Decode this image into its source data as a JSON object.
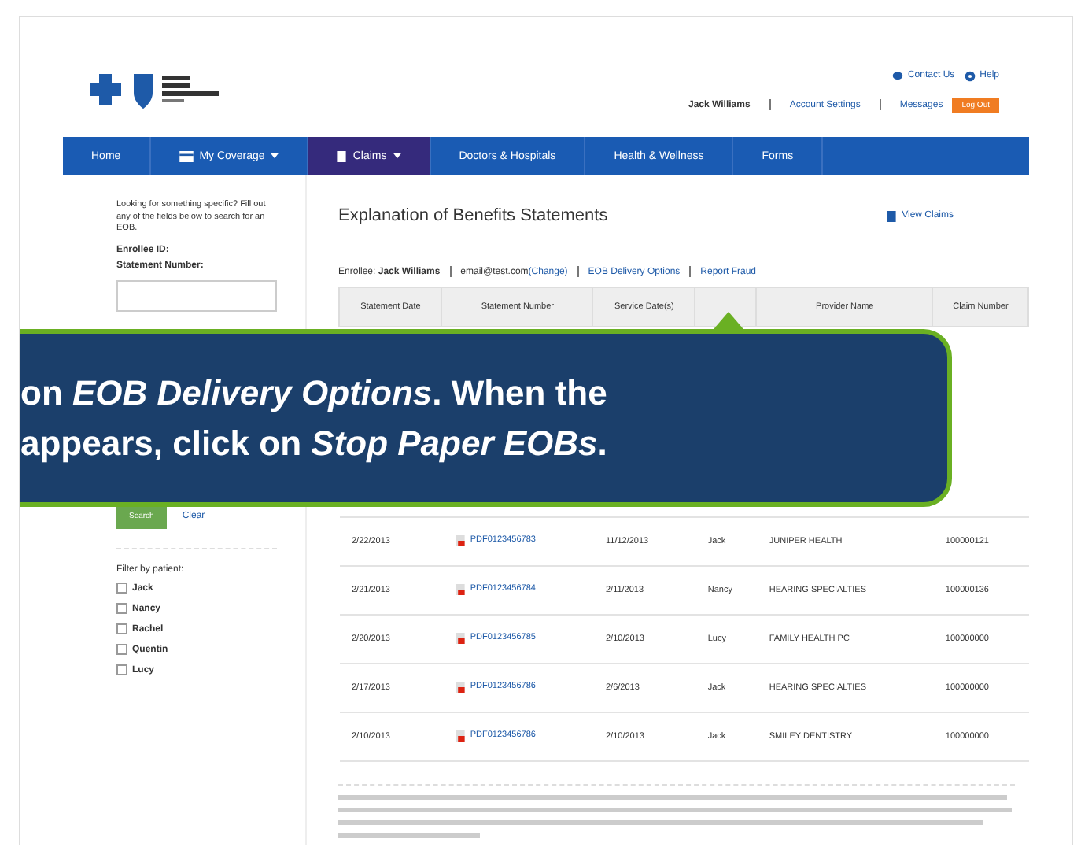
{
  "header": {
    "links": [
      "Contact Us",
      "Help"
    ],
    "user": "Jack Williams",
    "account_links": [
      "Account Settings",
      "Messages"
    ],
    "logout": "Log Out"
  },
  "nav": [
    {
      "label": "Home",
      "selected": false,
      "caret": false
    },
    {
      "label": "My Coverage",
      "selected": false,
      "caret": true
    },
    {
      "label": "Claims",
      "selected": true,
      "caret": true
    },
    {
      "label": "Doctors & Hospitals",
      "selected": false,
      "caret": false
    },
    {
      "label": "Health & Wellness",
      "selected": false,
      "caret": false
    },
    {
      "label": "Forms",
      "selected": false,
      "caret": false
    }
  ],
  "sidebar": {
    "intro": "Looking for something specific? Fill out any of the fields below to search for an EOB.",
    "fields": [
      "Enrollee ID:",
      "Statement Number:"
    ],
    "search_button": "Search",
    "clear_link": "Clear",
    "filter_title": "Filter by patient:",
    "patients": [
      {
        "label": "Jack",
        "checked": false
      },
      {
        "label": "Nancy",
        "checked": false
      },
      {
        "label": "Rachel",
        "checked": false
      },
      {
        "label": "Quentin",
        "checked": false
      },
      {
        "label": "Lucy",
        "checked": false
      }
    ]
  },
  "main": {
    "title": "Explanation of Benefits Statements",
    "view_claims": "View Claims",
    "enrollee_label": "Enrollee:",
    "enrollee_name": "Jack Williams",
    "email": "email@test.com",
    "change_link": "(Change)",
    "delivery_link": "EOB Delivery Options",
    "fraud_link": "Report Fraud"
  },
  "table": {
    "columns": [
      "Statement Date",
      "Statement Number",
      "Service Date(s)",
      "",
      "Provider Name",
      "Claim Number"
    ],
    "rows": [
      {
        "cells": [
          "2/22/2013",
          "PDF0123456783",
          "11/12/2013",
          "Jack",
          "JUNIPER HEALTH",
          "100000121"
        ]
      },
      {
        "cells": [
          "2/21/2013",
          "PDF0123456784",
          "2/11/2013",
          "Nancy",
          "HEARING SPECIALTIES",
          "100000136"
        ]
      },
      {
        "cells": [
          "2/20/2013",
          "PDF0123456785",
          "2/10/2013",
          "Lucy",
          "FAMILY HEALTH PC",
          "100000000"
        ]
      },
      {
        "cells": [
          "2/17/2013",
          "PDF0123456786",
          "2/6/2013",
          "Jack",
          "HEARING SPECIALTIES",
          "100000000"
        ]
      },
      {
        "cells": [
          "2/10/2013",
          "PDF0123456786",
          "2/10/2013",
          "Jack",
          "SMILEY DENTISTRY",
          "100000000"
        ]
      }
    ]
  },
  "callout": {
    "lines": [
      "on *EOB Delivery Options*. When the",
      "appears, click on *Stop Paper EOBs*."
    ]
  }
}
